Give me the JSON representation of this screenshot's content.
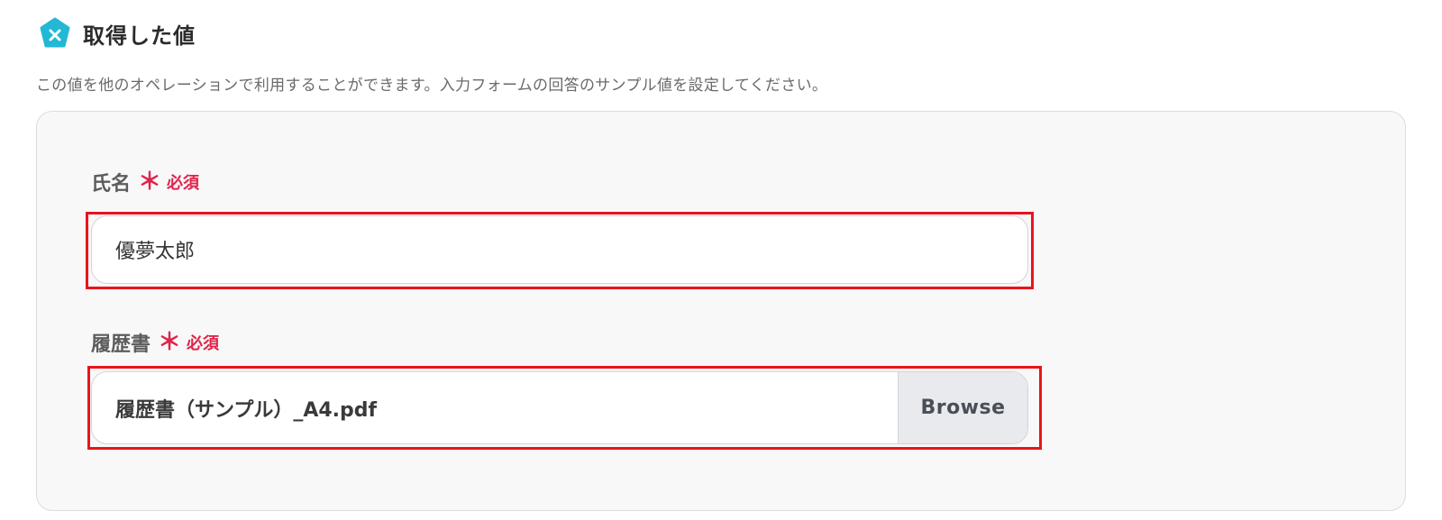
{
  "header": {
    "title": "取得した値",
    "icon": "variable-x-icon",
    "icon_color": "#22b8d6"
  },
  "description": "この値を他のオペレーションで利用することができます。入力フォームの回答のサンプル値を設定してください。",
  "fields": [
    {
      "label": "氏名",
      "asterisk": "＊",
      "required_text": "必須",
      "value": "優夢太郎"
    },
    {
      "label": "履歴書",
      "asterisk": "＊",
      "required_text": "必須",
      "file_name": "履歴書（サンプル）_A4.pdf",
      "button_label": "Browse"
    }
  ],
  "colors": {
    "required": "#e0244a",
    "highlight": "#e8141c",
    "panel_bg": "#f8f8f9"
  }
}
